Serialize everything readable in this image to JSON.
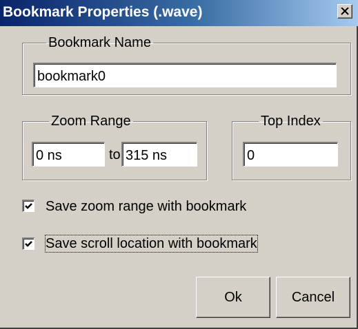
{
  "window": {
    "title": "Bookmark Properties (.wave)",
    "close_icon": "close-icon"
  },
  "bookmark_name": {
    "group_label": "Bookmark Name",
    "value": "bookmark0"
  },
  "zoom_range": {
    "group_label": "Zoom Range",
    "from_value": "0 ns",
    "to_label": "to",
    "to_value": "315 ns"
  },
  "top_index": {
    "group_label": "Top Index",
    "value": "0"
  },
  "options": {
    "save_zoom": {
      "label": "Save zoom range with bookmark",
      "checked": true
    },
    "save_scroll": {
      "label": "Save scroll location with bookmark",
      "checked": true
    }
  },
  "buttons": {
    "ok": "Ok",
    "cancel": "Cancel"
  },
  "colors": {
    "title_gradient_start": "#0a246a",
    "title_gradient_end": "#a6caf0",
    "face": "#d4d0c8"
  }
}
